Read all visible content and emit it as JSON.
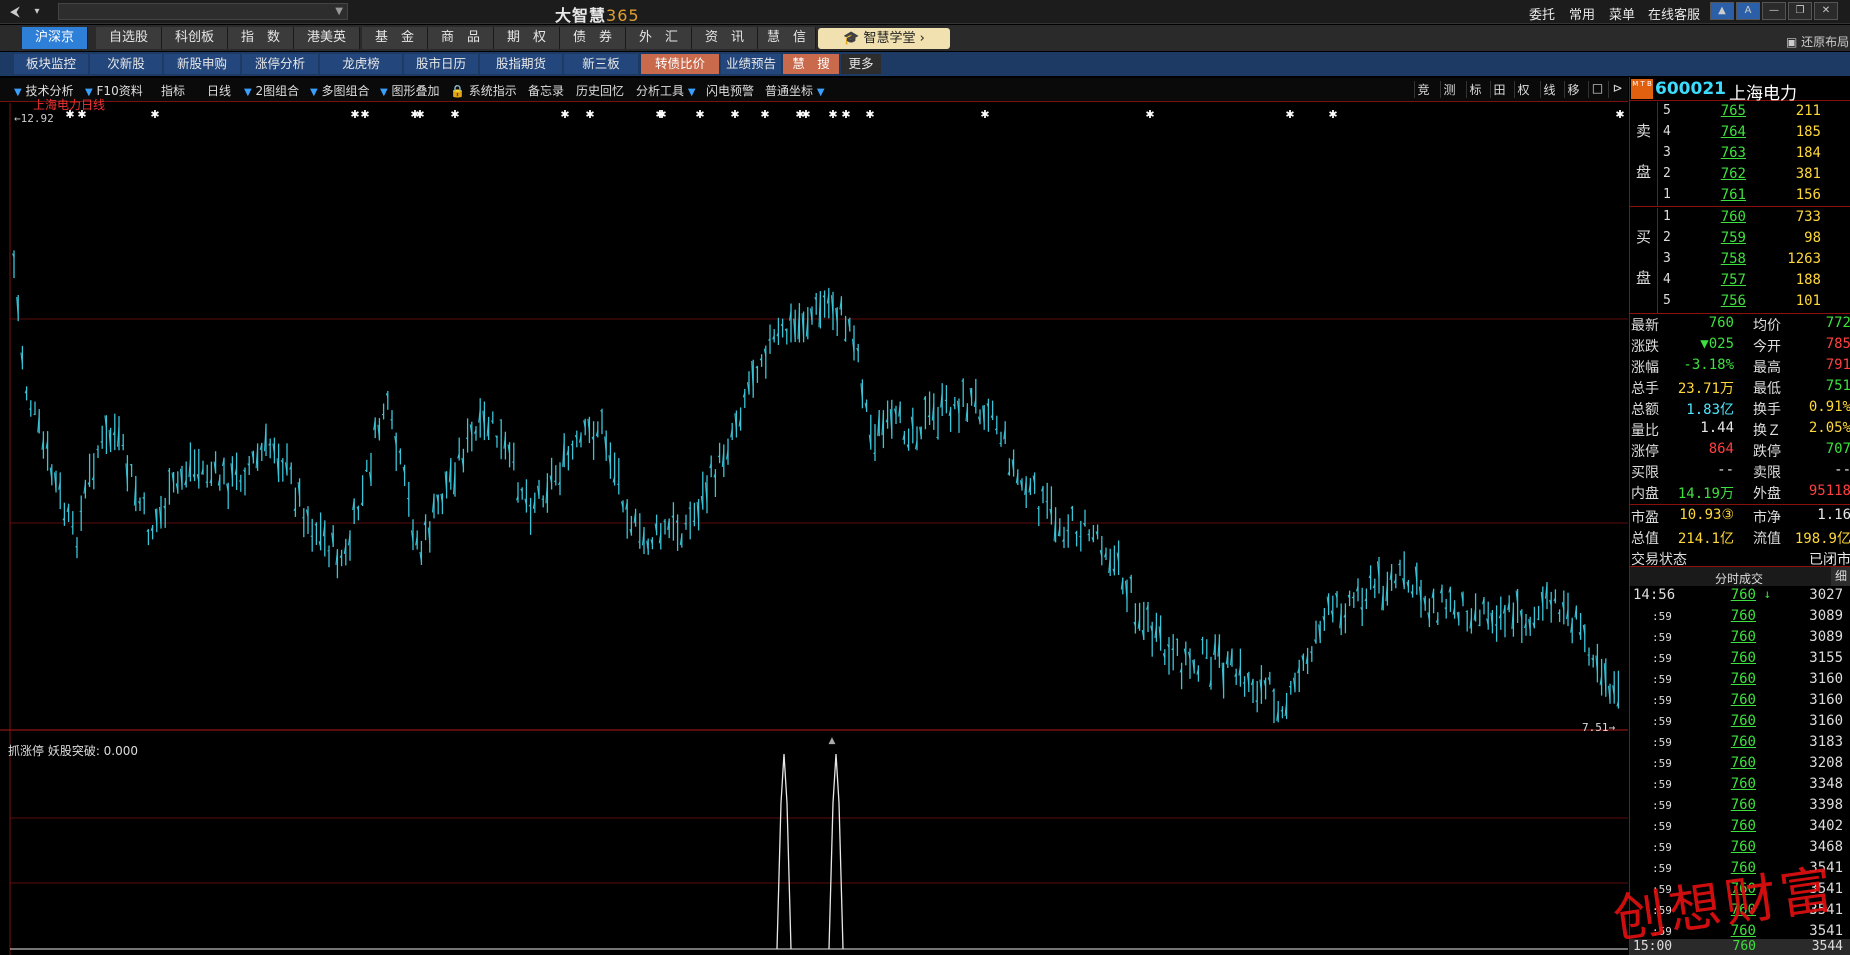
{
  "app": {
    "title_cn": "大智慧",
    "title_num": "365"
  },
  "topright": [
    "委托",
    "常用",
    "菜单",
    "在线客服"
  ],
  "menu": {
    "tabs": [
      "沪深京",
      "自选股",
      "科创板",
      "指　数",
      "港美英",
      "基　金",
      "商　品",
      "期　权",
      "债　券",
      "外　汇",
      "资　讯",
      "慧　信"
    ],
    "xuetang": "智慧学堂",
    "restore": "还原布局"
  },
  "subtabs": [
    "板块监控",
    "次新股",
    "新股申购",
    "涨停分析",
    "龙虎榜",
    "股市日历",
    "股指期货",
    "新三板",
    "转债比价",
    "业绩预告",
    "慧　搜",
    "更多"
  ],
  "toolbar": {
    "items": [
      "技术分析",
      "F10资料",
      "指标",
      "日线",
      "2图组合",
      "多图组合",
      "图形叠加",
      "系统指示",
      "备忘录",
      "历史回忆",
      "分析工具",
      "闪电预警",
      "普通坐标"
    ],
    "right": [
      "竞",
      "测",
      "标",
      "田",
      "权",
      "线",
      "移",
      "□",
      "⊳"
    ]
  },
  "chart": {
    "stock_label": "上海电力日线",
    "high_label": "←12.92",
    "low_label": "7.51→",
    "indicator_label": "抓涨停 妖股突破: 0.000"
  },
  "quote": {
    "code": "600021",
    "name": "上海电力",
    "mt_badge": "M T B",
    "sell_label": [
      "卖",
      "盘"
    ],
    "buy_label": [
      "买",
      "盘"
    ],
    "sell": [
      {
        "lv": "5",
        "price": "765",
        "vol": "211"
      },
      {
        "lv": "4",
        "price": "764",
        "vol": "185"
      },
      {
        "lv": "3",
        "price": "763",
        "vol": "184"
      },
      {
        "lv": "2",
        "price": "762",
        "vol": "381"
      },
      {
        "lv": "1",
        "price": "761",
        "vol": "156"
      }
    ],
    "buy": [
      {
        "lv": "1",
        "price": "760",
        "vol": "733"
      },
      {
        "lv": "2",
        "price": "759",
        "vol": "98"
      },
      {
        "lv": "3",
        "price": "758",
        "vol": "1263"
      },
      {
        "lv": "4",
        "price": "757",
        "vol": "188"
      },
      {
        "lv": "5",
        "price": "756",
        "vol": "101"
      }
    ],
    "stats": [
      {
        "k": "最新",
        "v": "760",
        "vc": "g",
        "k2": "均价",
        "v2": "772",
        "v2c": "g"
      },
      {
        "k": "涨跌",
        "v": "▼025",
        "vc": "g",
        "k2": "今开",
        "v2": "785",
        "v2c": "r"
      },
      {
        "k": "涨幅",
        "v": "-3.18%",
        "vc": "g",
        "k2": "最高",
        "v2": "791",
        "v2c": "r"
      },
      {
        "k": "总手",
        "v": "23.71万",
        "vc": "y",
        "k2": "最低",
        "v2": "751",
        "v2c": "g"
      },
      {
        "k": "总额",
        "v": "1.83亿",
        "vc": "c",
        "k2": "换手",
        "v2": "0.91%",
        "v2c": "y"
      },
      {
        "k": "量比",
        "v": "1.44",
        "vc": "w",
        "k2": "换Ｚ",
        "v2": "2.05%",
        "v2c": "y"
      },
      {
        "k": "涨停",
        "v": "864",
        "vc": "r",
        "k2": "跌停",
        "v2": "707",
        "v2c": "g"
      },
      {
        "k": "买限",
        "v": "--",
        "vc": "w",
        "k2": "卖限",
        "v2": "--",
        "v2c": "w"
      },
      {
        "k": "内盘",
        "v": "14.19万",
        "vc": "g",
        "k2": "外盘",
        "v2": "95118",
        "v2c": "r"
      },
      {
        "k": "市盈",
        "v": "10.93③",
        "vc": "y",
        "k2": "市净",
        "v2": "1.16",
        "v2c": "w"
      },
      {
        "k": "总值",
        "v": "214.1亿",
        "vc": "y",
        "k2": "流值",
        "v2": "198.9亿",
        "v2c": "y"
      },
      {
        "k": "交易状态",
        "v": "",
        "vc": "w",
        "k2": "",
        "v2": "已闭市",
        "v2c": "w"
      }
    ],
    "tick_header": "分时成交",
    "tick_header_right": "细",
    "ticks": [
      {
        "t": "14:56",
        "p": "760",
        "v": "3027",
        "arrow": "↓"
      },
      {
        "t": ":59",
        "p": "760",
        "v": "3089"
      },
      {
        "t": ":59",
        "p": "760",
        "v": "3089"
      },
      {
        "t": ":59",
        "p": "760",
        "v": "3155"
      },
      {
        "t": ":59",
        "p": "760",
        "v": "3160"
      },
      {
        "t": ":59",
        "p": "760",
        "v": "3160"
      },
      {
        "t": ":59",
        "p": "760",
        "v": "3160"
      },
      {
        "t": ":59",
        "p": "760",
        "v": "3183"
      },
      {
        "t": ":59",
        "p": "760",
        "v": "3208"
      },
      {
        "t": ":59",
        "p": "760",
        "v": "3348"
      },
      {
        "t": ":59",
        "p": "760",
        "v": "3398"
      },
      {
        "t": ":59",
        "p": "760",
        "v": "3402"
      },
      {
        "t": ":59",
        "p": "760",
        "v": "3468"
      },
      {
        "t": ":59",
        "p": "760",
        "v": "3541"
      },
      {
        "t": ":59",
        "p": "760",
        "v": "3541"
      },
      {
        "t": ":59",
        "p": "760",
        "v": "3541"
      },
      {
        "t": ":59",
        "p": "760",
        "v": "3541"
      }
    ],
    "last_tick": {
      "t": "15:00",
      "p": "760",
      "v": "3544"
    }
  },
  "watermark": "创想财富",
  "colors": {
    "candle": "#3ac4d8",
    "grid": "#7a1010",
    "accent": "#2e7fd8"
  }
}
